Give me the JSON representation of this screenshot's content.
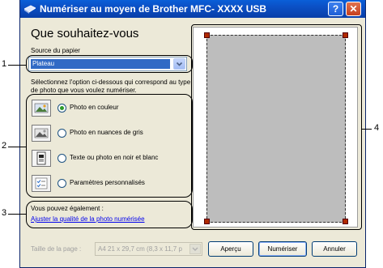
{
  "window": {
    "title": "Numériser au moyen de Brother MFC- XXXX USB",
    "help_label": "?",
    "close_label": "✕"
  },
  "panel": {
    "heading": "Que souhaitez-vous",
    "source_label": "Source du papier",
    "source_value": "Plateau",
    "instruction": "Sélectionnez l'option ci-dessous qui correspond au type de photo que vous voulez numériser.",
    "options": [
      {
        "label": "Photo en couleur",
        "icon": "color-photo-icon",
        "checked": true
      },
      {
        "label": "Photo en nuances de gris",
        "icon": "grayscale-photo-icon",
        "checked": false
      },
      {
        "label": "Texte ou photo en noir et blanc",
        "icon": "bw-text-icon",
        "checked": false
      },
      {
        "label": "Paramètres personnalisés",
        "icon": "custom-settings-icon",
        "checked": false
      }
    ],
    "also_label": "Vous pouvez également :",
    "adjust_link": "Ajuster la qualité de la photo numérisée"
  },
  "bottom": {
    "page_size_label": "Taille de la page :",
    "page_size_value": "A4 21 x 29,7 cm (8,3 x 11,7 p",
    "preview_button": "Aperçu",
    "scan_button": "Numériser",
    "cancel_button": "Annuler"
  },
  "callouts": [
    "1",
    "2",
    "3",
    "4"
  ],
  "colors": {
    "titlebar": "#0b4fc4",
    "selection": "#316ac5",
    "link": "#0000ee",
    "radio_checked": "#2c9a2a",
    "crop_handle": "#b02a00"
  }
}
